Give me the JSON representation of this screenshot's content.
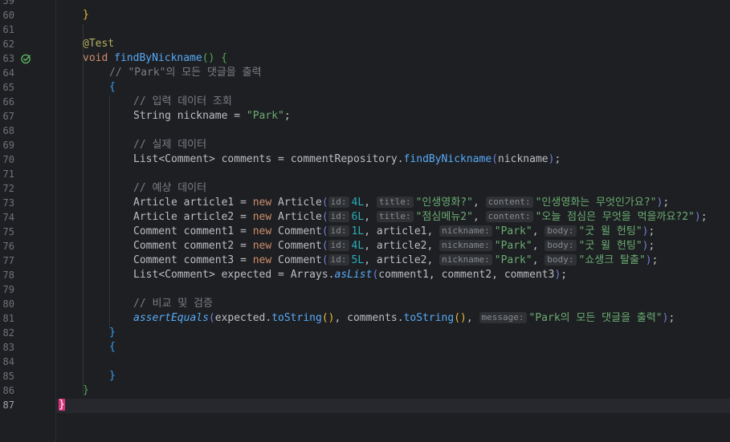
{
  "line_numbers": [
    "59",
    "60",
    "61",
    "62",
    "63",
    "64",
    "65",
    "66",
    "67",
    "68",
    "69",
    "70",
    "71",
    "72",
    "73",
    "74",
    "75",
    "76",
    "77",
    "78",
    "79",
    "80",
    "81",
    "82",
    "83",
    "84",
    "85",
    "86",
    "87"
  ],
  "current_line": "87",
  "icons": {
    "test_run": "test-passed-check-icon"
  },
  "code": {
    "l60": {
      "brace": "}"
    },
    "l62": {
      "annotation": "@Test"
    },
    "l63": {
      "void": "void",
      "method": "findByNickname",
      "parens": "()",
      "brace": "{"
    },
    "l64": {
      "comment": "// \"Park\"의 모든 댓글을 출력"
    },
    "l65": {
      "brace": "{"
    },
    "l66": {
      "comment": "// 입력 데이터 조회"
    },
    "l67": {
      "type": "String",
      "var": "nickname",
      "eq": " = ",
      "str": "\"Park\"",
      "end": ";"
    },
    "l69": {
      "comment": "// 실제 데이터"
    },
    "l70": {
      "type": "List",
      "lt": "<",
      "generic": "Comment",
      "gt": ">",
      "var": "comments",
      "eq": " = ",
      "obj": "commentRepository",
      "dot": ".",
      "call": "findByNickname",
      "open": "(",
      "arg": "nickname",
      "close": ")",
      "end": ";"
    },
    "l72": {
      "comment": "// 예상 데이터"
    },
    "l73": {
      "type": "Article",
      "var": "article1",
      "eq": " = ",
      "new": "new",
      "cls": "Article",
      "open": "(",
      "h1": "id:",
      "v1": "4L",
      "h2": "title:",
      "v2": "\"인생영화?\"",
      "h3": "content:",
      "v3": "\"인생영화는 무엇인가요?\"",
      "close": ")",
      "end": ";"
    },
    "l74": {
      "type": "Article",
      "var": "article2",
      "eq": " = ",
      "new": "new",
      "cls": "Article",
      "open": "(",
      "h1": "id:",
      "v1": "6L",
      "h2": "title:",
      "v2": "\"점심메뉴2\"",
      "h3": "content:",
      "v3": "\"오늘 점심은 무엇을 먹을까요?2\"",
      "close": ")",
      "end": ";"
    },
    "l75": {
      "type": "Comment",
      "var": "comment1",
      "eq": " = ",
      "new": "new",
      "cls": "Comment",
      "open": "(",
      "h1": "id:",
      "v1": "1L",
      "a": "article1",
      "h2": "nickname:",
      "v2": "\"Park\"",
      "h3": "body:",
      "v3": "\"굿 윌 헌팅\"",
      "close": ")",
      "end": ";"
    },
    "l76": {
      "type": "Comment",
      "var": "comment2",
      "eq": " = ",
      "new": "new",
      "cls": "Comment",
      "open": "(",
      "h1": "id:",
      "v1": "4L",
      "a": "article2",
      "h2": "nickname:",
      "v2": "\"Park\"",
      "h3": "body:",
      "v3": "\"굿 윌 헌팅\"",
      "close": ")",
      "end": ";"
    },
    "l77": {
      "type": "Comment",
      "var": "comment3",
      "eq": " = ",
      "new": "new",
      "cls": "Comment",
      "open": "(",
      "h1": "id:",
      "v1": "5L",
      "a": "article2",
      "h2": "nickname:",
      "v2": "\"Park\"",
      "h3": "body:",
      "v3": "\"쇼생크 탈출\"",
      "close": ")",
      "end": ";"
    },
    "l78": {
      "type": "List",
      "lt": "<",
      "generic": "Comment",
      "gt": ">",
      "var": "expected",
      "eq": " = ",
      "obj": "Arrays",
      "dot": ".",
      "call": "asList",
      "open": "(",
      "args": "comment1, comment2, comment3",
      "close": ")",
      "end": ";"
    },
    "l80": {
      "comment": "// 비교 및 검증"
    },
    "l81": {
      "call": "assertEquals",
      "open": "(",
      "a1": "expected",
      "m1": "toString",
      "a2": "comments",
      "m2": "toString",
      "h": "message:",
      "s": "\"Park의 모든 댓글을 출력\"",
      "close": ")",
      "end": ";"
    },
    "l82": {
      "brace": "}"
    },
    "l83": {
      "brace": "{"
    },
    "l85": {
      "brace": "}"
    },
    "l86": {
      "brace": "}"
    },
    "l87": {
      "brace": "}"
    }
  }
}
